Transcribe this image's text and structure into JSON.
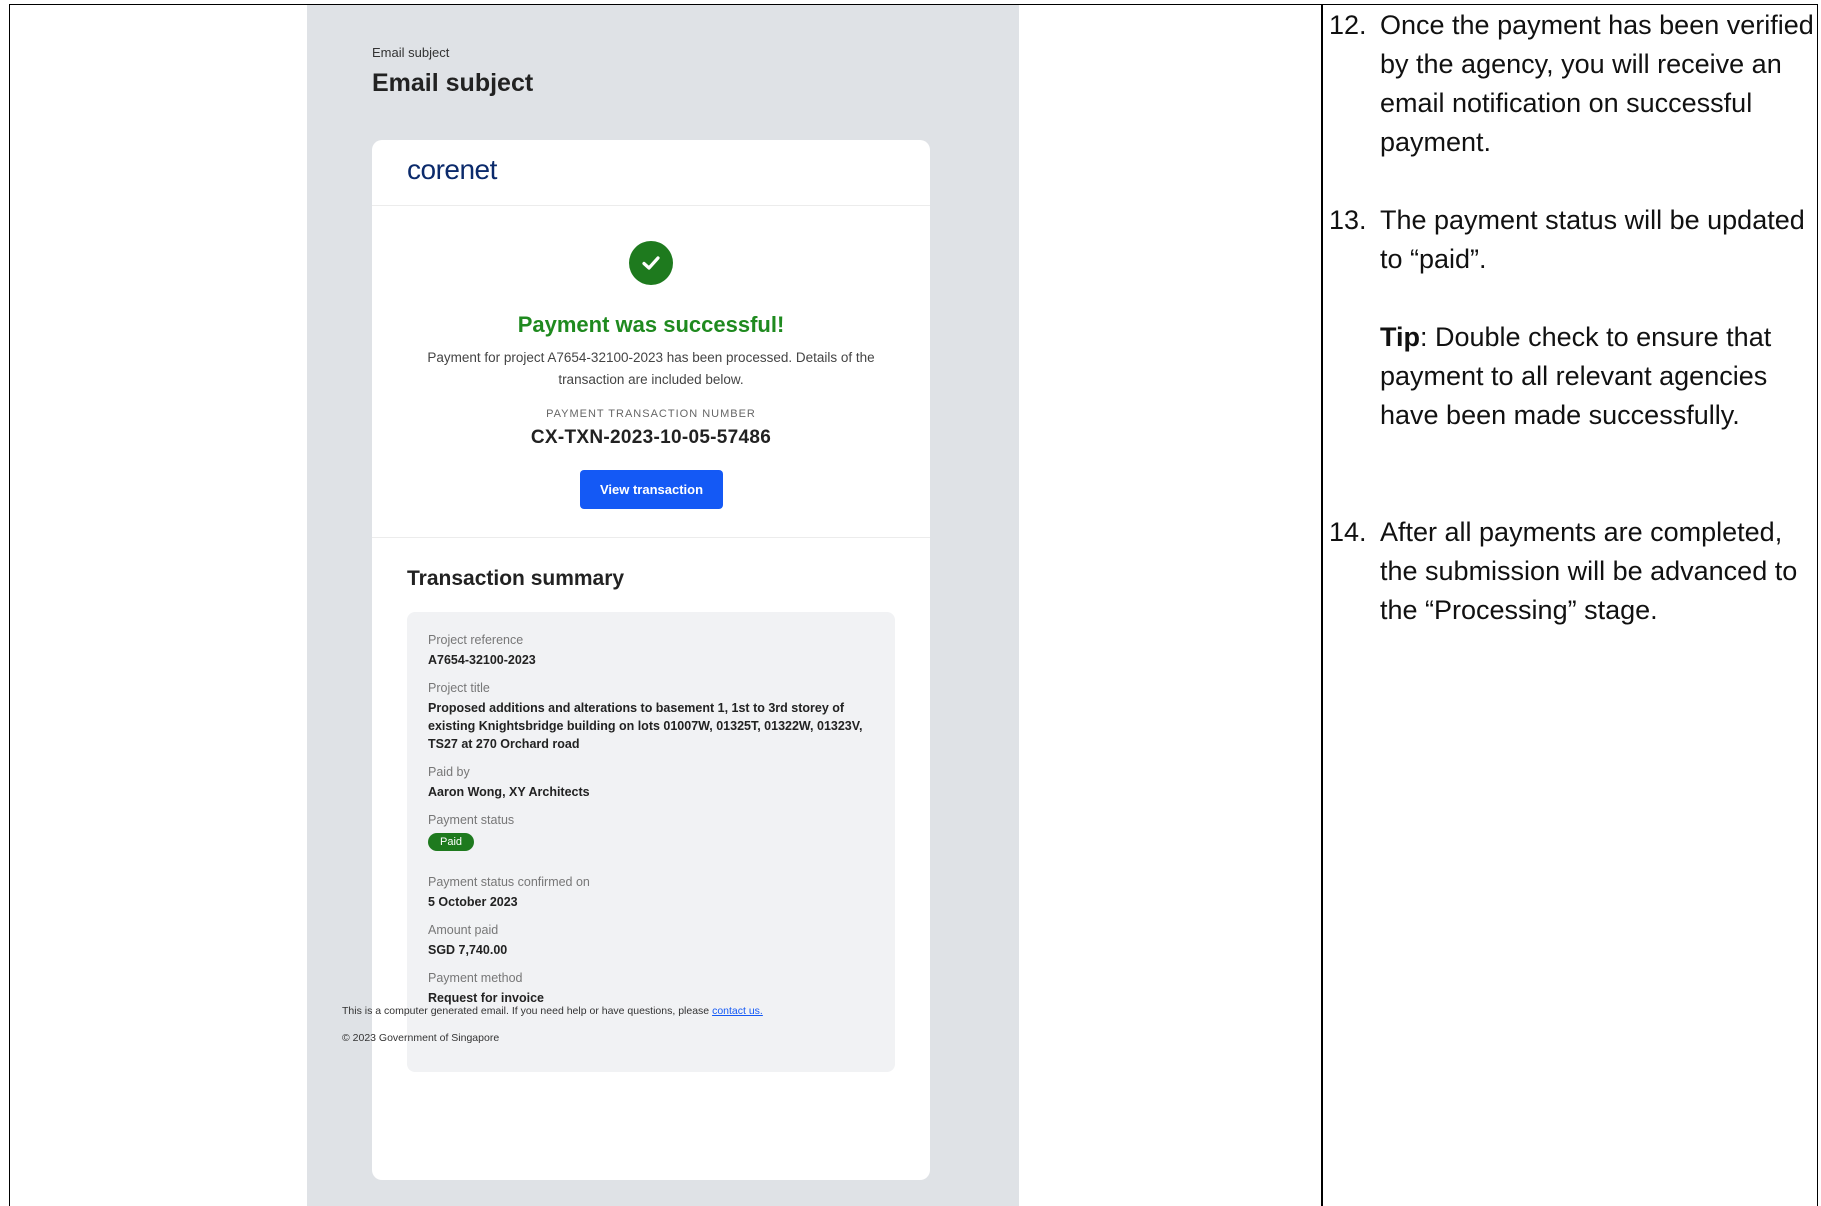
{
  "email": {
    "subject_label": "Email subject",
    "subject_title": "Email subject",
    "logo_text": "corenet",
    "success_title": "Payment was successful!",
    "success_desc": "Payment for project A7654-32100-2023 has been processed. Details of the transaction are included below.",
    "txn_label": "PAYMENT TRANSACTION NUMBER",
    "txn_number": "CX-TXN-2023-10-05-57486",
    "view_button": "View transaction",
    "summary_title": "Transaction summary",
    "fields": {
      "project_reference": {
        "label": "Project reference",
        "value": "A7654-32100-2023"
      },
      "project_title": {
        "label": "Project title",
        "value": "Proposed additions and alterations to basement 1, 1st to 3rd storey of existing Knightsbridge building on lots 01007W, 01325T, 01322W, 01323V, TS27 at 270 Orchard road"
      },
      "paid_by": {
        "label": "Paid by",
        "value": "Aaron Wong, XY Architects"
      },
      "payment_status": {
        "label": "Payment status",
        "value": "Paid"
      },
      "confirmed_on": {
        "label": "Payment status confirmed on",
        "value": "5 October 2023"
      },
      "amount_paid": {
        "label": "Amount paid",
        "value": "SGD 7,740.00"
      },
      "payment_method": {
        "label": "Payment method",
        "value": "Request for invoice"
      }
    },
    "footer_text": "This is a computer generated email. If you need help or have questions, please",
    "footer_link": "contact us.",
    "footer_copy": "© 2023 Government of Singapore"
  },
  "instructions": {
    "step12": {
      "num": "12.",
      "text": "Once the payment has been verified by the agency, you will receive an email notification on successful payment."
    },
    "step13": {
      "num": "13.",
      "text": "The payment status will be updated to “paid”."
    },
    "tip": {
      "label": "Tip",
      "text": ": Double check to ensure that payment to all relevant agencies have been made successfully."
    },
    "step14": {
      "num": "14.",
      "text": "After all payments are completed, the submission will be advanced to the “Processing” stage."
    }
  },
  "colors": {
    "success_green": "#1f8a1f",
    "button_blue": "#1459f5",
    "logo_navy": "#0b2a6b",
    "panel_grey": "#dfe2e6"
  }
}
